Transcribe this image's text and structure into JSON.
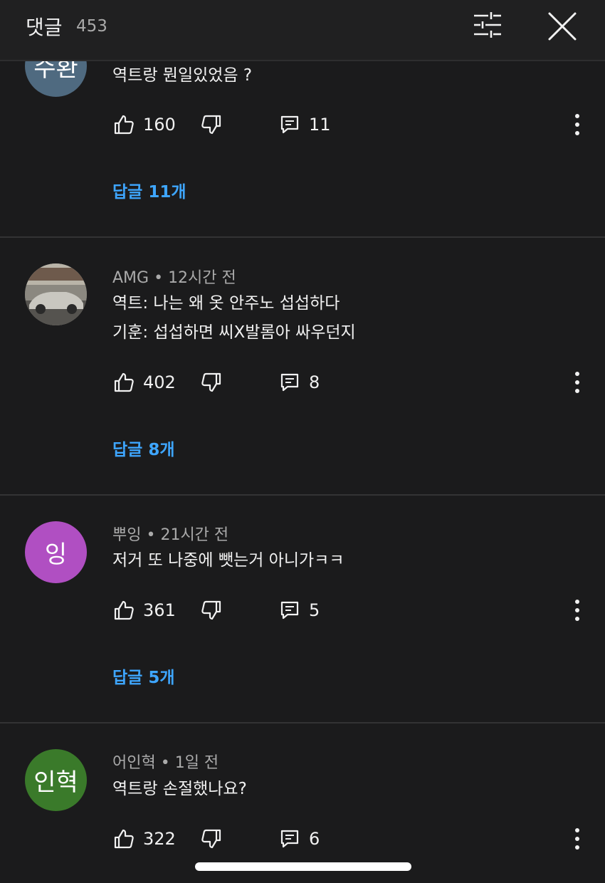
{
  "header": {
    "title": "댓글",
    "count": "453",
    "filter_icon": "sliders-icon",
    "close_icon": "close-icon"
  },
  "comments": [
    {
      "avatar_text": "수환",
      "avatar_color": "#4f6a80",
      "author": "",
      "time": "",
      "lines": [
        "역트랑 뭔일있었음 ?"
      ],
      "likes": "160",
      "reply_count": "11",
      "replies_label": "답글 11개"
    },
    {
      "avatar_text": "",
      "avatar_color": "#7a7a78",
      "author": "AMG",
      "time": "12시간 전",
      "lines": [
        "역트: 나는 왜 옷 안주노 섭섭하다",
        "기훈: 섭섭하면 씨X발롬아 싸우던지"
      ],
      "likes": "402",
      "reply_count": "8",
      "replies_label": "답글 8개"
    },
    {
      "avatar_text": "잉",
      "avatar_color": "#b04fc2",
      "author": "뿌잉",
      "time": "21시간 전",
      "lines": [
        "저거 또 나중에 뺏는거 아니가ㅋㅋ"
      ],
      "likes": "361",
      "reply_count": "5",
      "replies_label": "답글 5개"
    },
    {
      "avatar_text": "인혁",
      "avatar_color": "#3a7a2a",
      "author": "어인혁",
      "time": "1일 전",
      "lines": [
        "역트랑 손절했나요?"
      ],
      "likes": "322",
      "reply_count": "6",
      "replies_label": ""
    }
  ],
  "icons": {
    "like": "thumbs-up-icon",
    "dislike": "thumbs-down-icon",
    "reply": "comment-icon",
    "more": "more-vertical-icon"
  },
  "colors": {
    "background": "#1b1b1c",
    "link": "#3ea6ff",
    "muted": "#aaaaaa"
  }
}
